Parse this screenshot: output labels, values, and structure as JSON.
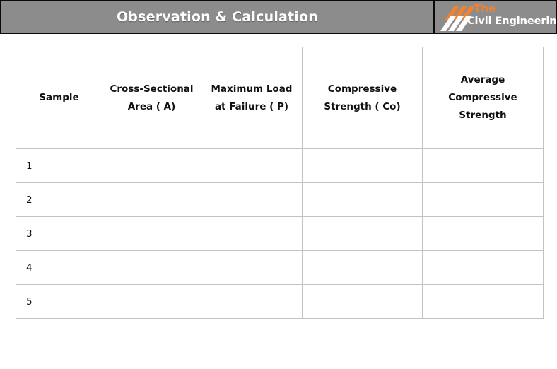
{
  "header": {
    "title": "Observation & Calculation",
    "logo": {
      "slashes_icon": "diagonal-slashes-icon",
      "top_text": "The",
      "main_text": "Civil Engineering",
      "accent_color": "#e8833a",
      "text_color": "#ffffff"
    },
    "background_color": "#8c8c8c",
    "border_color": "#0a0a0a"
  },
  "table": {
    "columns": [
      "Sample",
      "Cross-Sectional Area ( A)",
      "Maximum Load at Failure ( P)",
      "Compressive Strength ( Co)",
      "Average Compressive Strength"
    ],
    "rows": [
      {
        "sample": "1",
        "area": "",
        "load": "",
        "strength": "",
        "average": ""
      },
      {
        "sample": "2",
        "area": "",
        "load": "",
        "strength": "",
        "average": ""
      },
      {
        "sample": "3",
        "area": "",
        "load": "",
        "strength": "",
        "average": ""
      },
      {
        "sample": "4",
        "area": "",
        "load": "",
        "strength": "",
        "average": ""
      },
      {
        "sample": "5",
        "area": "",
        "load": "",
        "strength": "",
        "average": ""
      }
    ],
    "border_color": "#c3c3c3"
  }
}
